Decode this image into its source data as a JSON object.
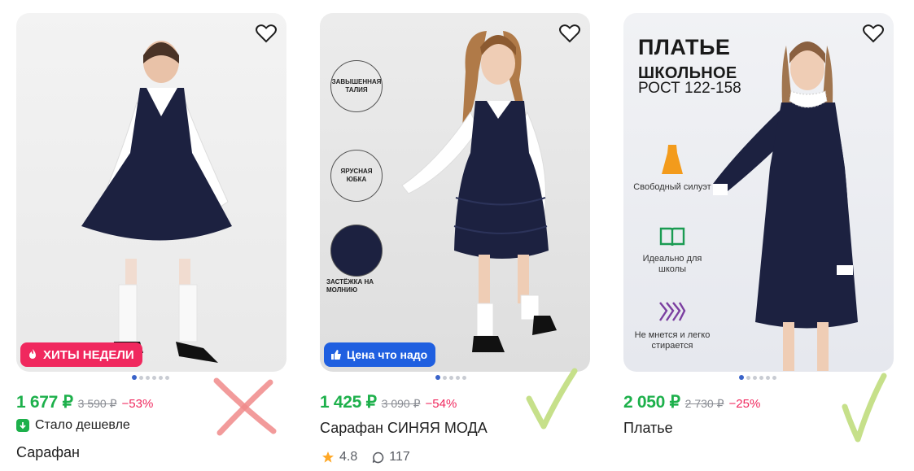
{
  "products": [
    {
      "badge_label": "ХИТЫ НЕДЕЛИ",
      "price": "1 677 ₽",
      "old_price": "3 590 ₽",
      "discount": "−53%",
      "promo_label": "Стало дешевле",
      "title": "Сарафан",
      "accent_color": "#1db04b"
    },
    {
      "badge_label": "Цена что надо",
      "price": "1 425 ₽",
      "old_price": "3 090 ₽",
      "discount": "−54%",
      "title": "Сарафан СИНЯЯ МОДА",
      "rating": "4.8",
      "reviews": "117",
      "photo_labels": [
        "ЗАВЫШЕННАЯ ТАЛИЯ",
        "ЯРУСНАЯ ЮБКА",
        "ЗАСТЁЖКА НА МОЛНИЮ"
      ]
    },
    {
      "price": "2 050 ₽",
      "old_price": "2 730 ₽",
      "discount": "−25%",
      "title": "Платье",
      "poster": {
        "title_line1": "ПЛАТЬЕ",
        "title_line2": "ШКОЛЬНОЕ",
        "size_range": "РОСТ 122-158",
        "features": [
          "Свободный силуэт",
          "Идеально для школы",
          "Не мнется и легко стирается"
        ]
      }
    }
  ],
  "colors": {
    "price_green": "#1db04b",
    "discount_red": "#f0285e",
    "hit_badge": "#f0285e",
    "price_badge": "#1f5fe0",
    "annotation_x": "#f08a8a",
    "annotation_check": "#c6e08a"
  },
  "icons": [
    "heart-icon",
    "fire-icon",
    "thumbs-up-icon",
    "price-down-icon",
    "star-icon",
    "chat-icon"
  ]
}
